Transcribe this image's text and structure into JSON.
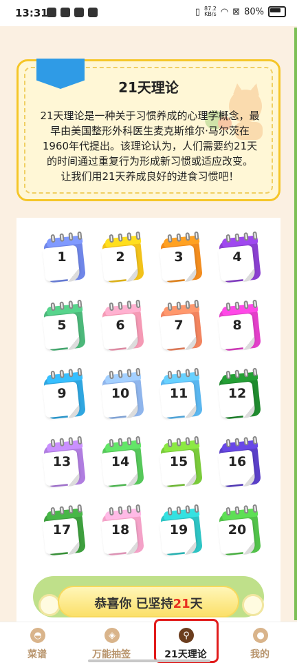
{
  "status_bar": {
    "time": "13:31",
    "speed_value": "87.2",
    "speed_unit": "KB/s",
    "battery": "80%"
  },
  "intro_card": {
    "title": "21天理论",
    "lines": [
      "21天理论是一种关于习惯养成的心理学概念，最",
      "早由美国整形外科医生麦克斯维尔·马尔茨在",
      "1960年代提出。该理论认为，人们需要约21天",
      "的时间通过重复行为形成新习惯或适应改变。",
      "让我们用21天养成良好的进食习惯吧！"
    ]
  },
  "calendar_days": [
    {
      "label": "1",
      "color": "#6f86e8"
    },
    {
      "label": "2",
      "color": "#f2c21a"
    },
    {
      "label": "3",
      "color": "#f28c1e"
    },
    {
      "label": "4",
      "color": "#8a3fd0"
    },
    {
      "label": "5",
      "color": "#4cb87a"
    },
    {
      "label": "6",
      "color": "#f59ab5"
    },
    {
      "label": "7",
      "color": "#f2845f"
    },
    {
      "label": "8",
      "color": "#e23fc9"
    },
    {
      "label": "9",
      "color": "#2fa6e0"
    },
    {
      "label": "10",
      "color": "#8fb5ec"
    },
    {
      "label": "11",
      "color": "#5ab6ef"
    },
    {
      "label": "12",
      "color": "#1f8a2e"
    },
    {
      "label": "13",
      "color": "#b07de0"
    },
    {
      "label": "14",
      "color": "#56c85a"
    },
    {
      "label": "15",
      "color": "#7acb3a"
    },
    {
      "label": "16",
      "color": "#5a3fc8"
    },
    {
      "label": "17",
      "color": "#3e9f3e"
    },
    {
      "label": "18",
      "color": "#f4a2c8"
    },
    {
      "label": "19",
      "color": "#2dc4c4"
    },
    {
      "label": "20",
      "color": "#52c24a"
    }
  ],
  "banner": {
    "prefix": "恭喜你 已坚持",
    "days": "21",
    "suffix": "天"
  },
  "bottom_nav": [
    {
      "label": "菜谱",
      "icon": "chef-hat-icon",
      "active": false
    },
    {
      "label": "万能抽签",
      "icon": "tag-icon",
      "active": false
    },
    {
      "label": "21天理论",
      "icon": "route-icon",
      "active": true
    },
    {
      "label": "我的",
      "icon": "user-icon",
      "active": false
    }
  ],
  "colors": {
    "accent_yellow": "#f5c628",
    "ribbon_blue": "#2f9be6",
    "highlight_red": "#e8301f",
    "nav_active": "#6b3d1e",
    "nav_inactive": "#b8946c"
  }
}
